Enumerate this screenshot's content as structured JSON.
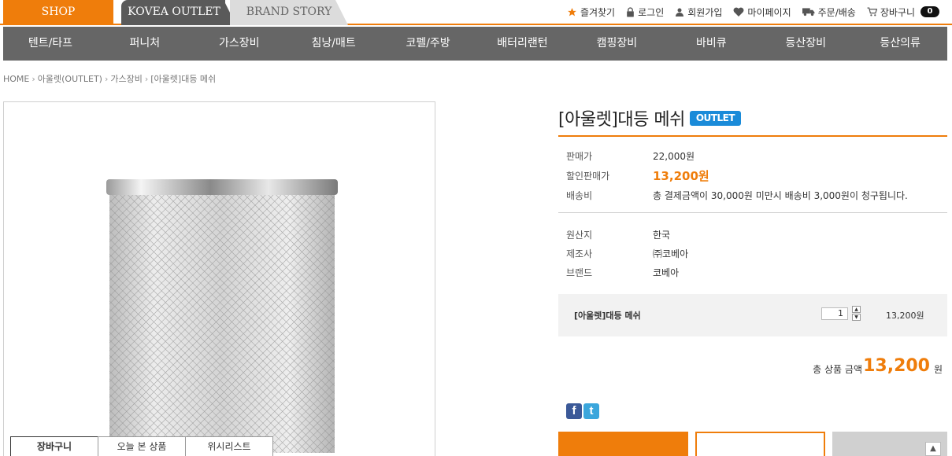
{
  "top_tabs": {
    "shop": "SHOP",
    "outlet": "KOVEA OUTLET",
    "brand": "BRAND STORY"
  },
  "utility_links": [
    {
      "label": "즐겨찾기",
      "icon": "star-icon"
    },
    {
      "label": "로그인",
      "icon": "lock-icon"
    },
    {
      "label": "회원가입",
      "icon": "user-icon"
    },
    {
      "label": "마이페이지",
      "icon": "heart-icon"
    },
    {
      "label": "주문/배송",
      "icon": "truck-icon"
    },
    {
      "label": "장바구니",
      "icon": "cart-icon"
    }
  ],
  "cart_count": "0",
  "categories": [
    "텐트/타프",
    "퍼니처",
    "가스장비",
    "침낭/매트",
    "코펠/주방",
    "배터리랜턴",
    "캠핑장비",
    "바비큐",
    "등산장비",
    "등산의류"
  ],
  "breadcrumb": [
    "HOME",
    "아울렛(OUTLET)",
    "가스장비",
    "[아울렛]대등 메쉬"
  ],
  "product": {
    "title": "[아울렛]대등 메쉬",
    "badge": "OUTLET",
    "price_label": "판매가",
    "price": "22,000원",
    "sale_label": "할인판매가",
    "sale_price": "13,200원",
    "shipping_label": "배송비",
    "shipping": "총 결제금액이 30,000원 미만시 배송비 3,000원이 청구됩니다.",
    "origin_label": "원산지",
    "origin": "한국",
    "maker_label": "제조사",
    "maker": "㈜코베아",
    "brand_label": "브랜드",
    "brand": "코베아"
  },
  "option": {
    "name": "[아울렛]대등 메쉬",
    "quantity": "1",
    "price": "13,200원"
  },
  "total": {
    "label": "총 상품 금액",
    "value": "13,200",
    "unit": "원"
  },
  "image_tabs": [
    "장바구니",
    "오늘 본 상품",
    "위시리스트"
  ],
  "colors": {
    "accent": "#ef7d0b",
    "nav": "#666666",
    "badge": "#1a8bd9"
  }
}
